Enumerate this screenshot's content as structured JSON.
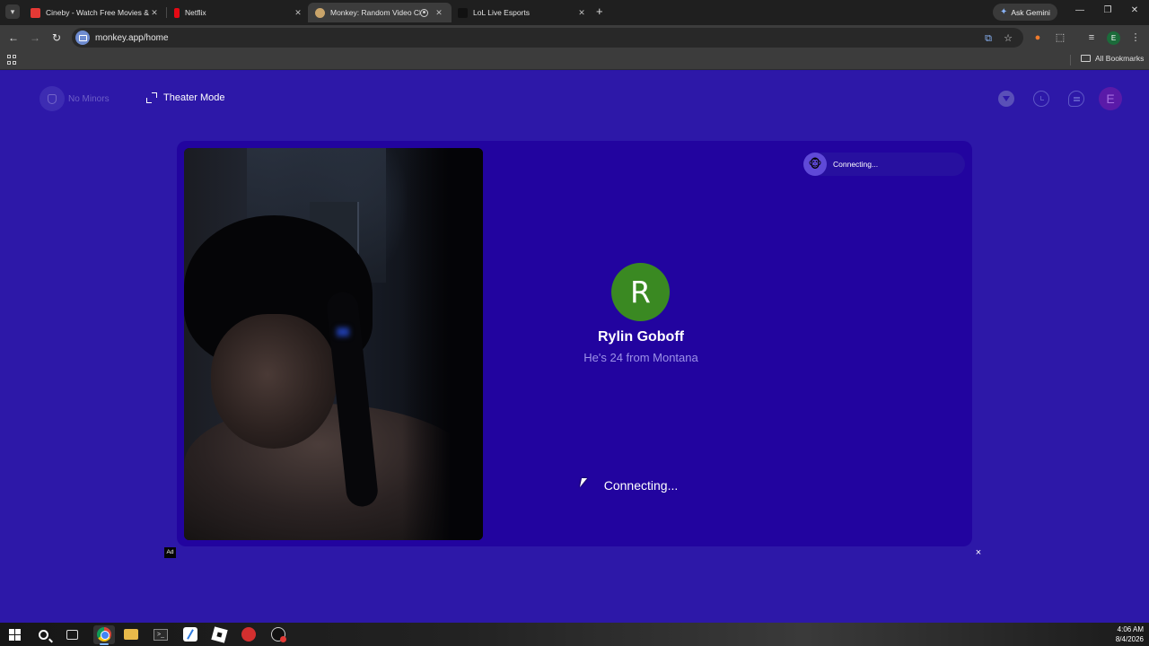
{
  "browser": {
    "tabs": [
      {
        "title": "Cineby - Watch Free Movies & TV Shows",
        "favicon_color": "#e53935",
        "active": false
      },
      {
        "title": "Netflix",
        "favicon_color": "#e50914",
        "active": false
      },
      {
        "title": "Monkey: Random Video Chat",
        "favicon_color": "#c9a46a",
        "active": true
      },
      {
        "title": "LoL Live Esports",
        "favicon_color": "#111111",
        "active": false
      }
    ],
    "ask_gemini": "Ask Gemini",
    "url": "monkey.app/home",
    "profile_initial": "E",
    "all_bookmarks": "All Bookmarks"
  },
  "page": {
    "no_minors_label": "No Minors",
    "theater_mode_label": "Theater Mode",
    "user_initial": "E",
    "chip_status": "Connecting...",
    "partner": {
      "initial": "R",
      "name": "Rylin Goboff",
      "info": "He's 24 from Montana",
      "avatar_color": "#3a8922"
    },
    "status": "Connecting...",
    "ad_label": "Ad",
    "ad_close": "×"
  },
  "colors": {
    "page_bg": "#2d18a8",
    "stage_bg": "#22049f",
    "accent_muted": "#9d92e8"
  },
  "taskbar": {
    "icons": [
      "windows-start-icon",
      "search-icon",
      "task-view-icon",
      "chrome-icon",
      "file-explorer-icon",
      "terminal-icon",
      "notes-icon",
      "roblox-icon",
      "red-app-icon",
      "github-icon"
    ],
    "time": "4:06 AM",
    "date": "8/4/2026"
  }
}
